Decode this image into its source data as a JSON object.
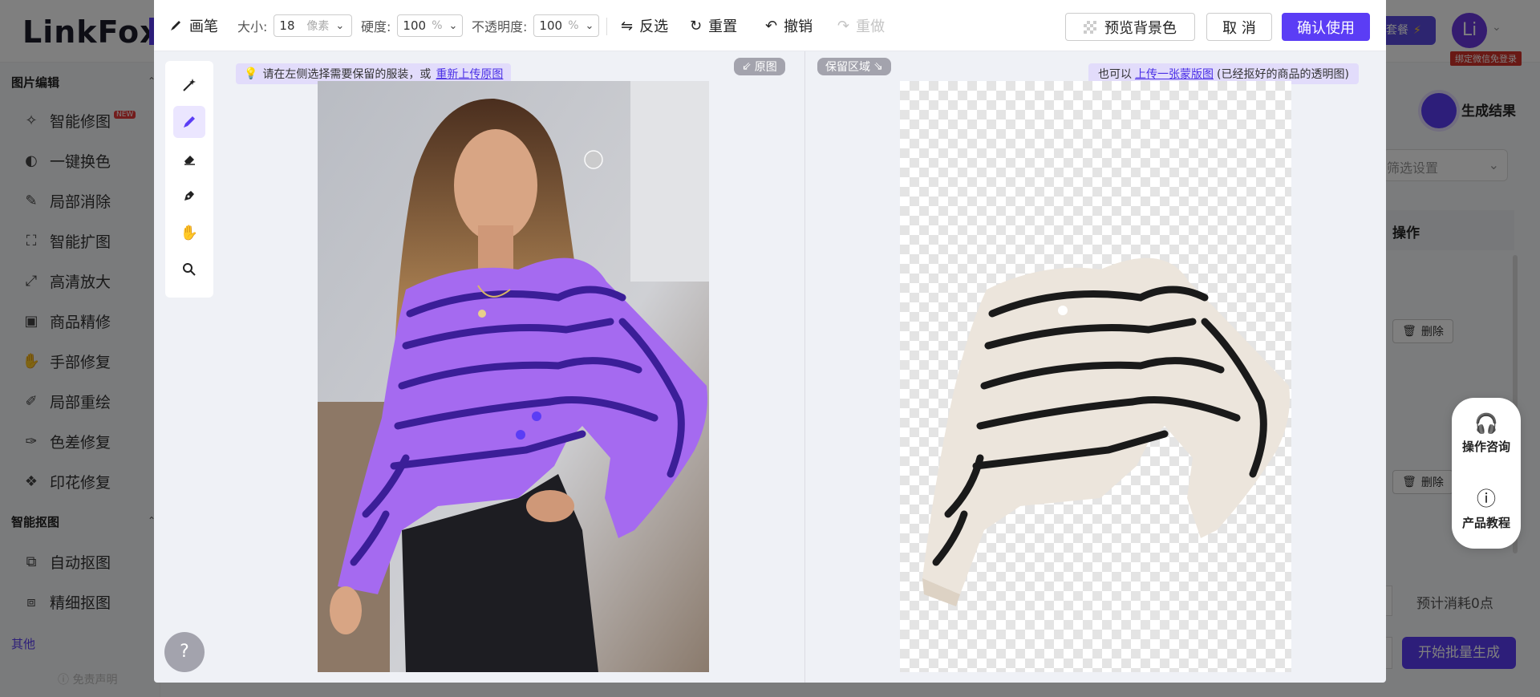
{
  "app": {
    "logo": "LinkFox",
    "vip_label": "套餐",
    "avatar_text": "Li",
    "wechat_badge": "绑定微信免登录"
  },
  "sidebar": {
    "group_image_edit": "图片编辑",
    "items_edit": [
      {
        "label": "智能修图",
        "icon": "magic-sparkle-icon",
        "badge": "NEW"
      },
      {
        "label": "一键换色",
        "icon": "color-swap-icon"
      },
      {
        "label": "局部消除",
        "icon": "eraser-pen-icon"
      },
      {
        "label": "智能扩图",
        "icon": "expand-corners-icon"
      },
      {
        "label": "高清放大",
        "icon": "upscale-icon"
      },
      {
        "label": "商品精修",
        "icon": "product-polish-icon"
      },
      {
        "label": "手部修复",
        "icon": "hand-icon"
      },
      {
        "label": "局部重绘",
        "icon": "repaint-icon"
      },
      {
        "label": "色差修复",
        "icon": "color-fix-icon"
      },
      {
        "label": "印花修复",
        "icon": "print-fix-icon"
      }
    ],
    "group_matting": "智能抠图",
    "items_matting": [
      {
        "label": "自动抠图",
        "icon": "auto-cutout-icon"
      },
      {
        "label": "精细抠图",
        "icon": "fine-cutout-icon"
      }
    ],
    "group_other": "其他",
    "disclaimer": "免责声明"
  },
  "right_panel": {
    "result_label": "生成结果",
    "filter_placeholder": "筛选设置",
    "operation_header": "操作",
    "delete_label": "删除",
    "cost_text": "预计消耗0点",
    "batch_button": "开始批量生成"
  },
  "float_panel": {
    "consult": "操作咨询",
    "tutorial": "产品教程"
  },
  "editor": {
    "toolbar": {
      "brush_label": "画笔",
      "size_label": "大小:",
      "size_value": "18",
      "size_unit": "像素",
      "hardness_label": "硬度:",
      "hardness_value": "100",
      "hardness_unit": "%",
      "opacity_label": "不透明度:",
      "opacity_value": "100",
      "opacity_unit": "%",
      "invert_label": "反选",
      "reset_label": "重置",
      "undo_label": "撤销",
      "redo_label": "重做",
      "preview_bg_label": "预览背景色",
      "cancel_label": "取 消",
      "confirm_label": "确认使用"
    },
    "rail_tools": [
      "magic-wand-icon",
      "brush-icon",
      "eraser-icon",
      "pen-icon",
      "hand-icon",
      "zoom-icon"
    ],
    "active_tool": "brush-icon",
    "hint_left_text": "请在左侧选择需要保留的服装，或",
    "hint_left_link": "重新上传原图",
    "original_tag": "原图",
    "keep_area_tag": "保留区域",
    "hint_right_prefix": "也可以",
    "hint_right_link": "上传一张蒙版图",
    "hint_right_suffix": "(已经抠好的商品的透明图)",
    "help_label": "?"
  },
  "colors": {
    "accent": "#5b3df5",
    "mask_purple": "#a56af0",
    "stripe_dark": "#3b1e98",
    "sweater_cream": "#ece5dc"
  }
}
